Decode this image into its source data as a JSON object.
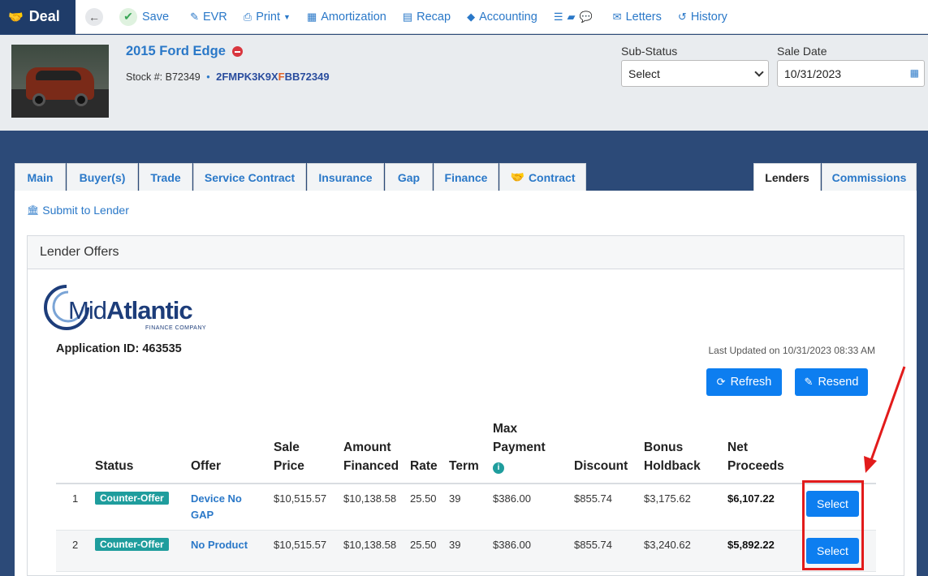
{
  "toolbar": {
    "brand": "Deal",
    "save": "Save",
    "evr": "EVR",
    "print": "Print",
    "amortization": "Amortization",
    "recap": "Recap",
    "accounting": "Accounting",
    "letters": "Letters",
    "history": "History"
  },
  "vehicle": {
    "title": "2015 Ford Edge",
    "stock_label": "Stock #: B72349",
    "vin_part1": "2FMPK3K9X",
    "vin_highlight": "F",
    "vin_part2": "BB72349",
    "sub_status_label": "Sub-Status",
    "sub_status_value": "Select",
    "sale_date_label": "Sale Date",
    "sale_date_value": "10/31/2023"
  },
  "tabs": {
    "main": "Main",
    "buyers": "Buyer(s)",
    "trade": "Trade",
    "service_contract": "Service Contract",
    "insurance": "Insurance",
    "gap": "Gap",
    "finance": "Finance",
    "contract": "Contract",
    "lenders": "Lenders",
    "commissions": "Commissions"
  },
  "lenders": {
    "submit_link": "Submit to Lender",
    "card_title": "Lender Offers",
    "logo_text_light": "Mid",
    "logo_text_bold": "Atlantic",
    "logo_sub": "FINANCE COMPANY",
    "application_id": "Application ID: 463535",
    "last_updated": "Last Updated on 10/31/2023 08:33 AM",
    "refresh_button": "Refresh",
    "resend_button": "Resend"
  },
  "table": {
    "headers": {
      "status": "Status",
      "offer": "Offer",
      "sale_price_1": "Sale",
      "sale_price_2": "Price",
      "amount_financed_1": "Amount",
      "amount_financed_2": "Financed",
      "rate": "Rate",
      "term": "Term",
      "max_payment_1": "Max",
      "max_payment_2": "Payment",
      "discount": "Discount",
      "bonus_holdback_1": "Bonus",
      "bonus_holdback_2": "Holdback",
      "net_proceeds_1": "Net",
      "net_proceeds_2": "Proceeds"
    },
    "rows": [
      {
        "num": "1",
        "status": "Counter-Offer",
        "offer_line1": "Device No",
        "offer_line2": "GAP",
        "sale_price": "$10,515.57",
        "amount_financed": "$10,138.58",
        "rate": "25.50",
        "term": "39",
        "max_payment": "$386.00",
        "discount": "$855.74",
        "bonus_holdback": "$3,175.62",
        "net_proceeds": "$6,107.22",
        "action": "Select"
      },
      {
        "num": "2",
        "status": "Counter-Offer",
        "offer_line1": "No Product",
        "offer_line2": "",
        "sale_price": "$10,515.57",
        "amount_financed": "$10,138.58",
        "rate": "25.50",
        "term": "39",
        "max_payment": "$386.00",
        "discount": "$855.74",
        "bonus_holdback": "$3,240.62",
        "net_proceeds": "$5,892.22",
        "action": "Select"
      }
    ]
  },
  "colors": {
    "primary": "#0d7ef0",
    "link": "#2a78c8",
    "navy": "#1f3c69",
    "badge": "#1f9d9d",
    "annotation": "#e21b1b"
  }
}
